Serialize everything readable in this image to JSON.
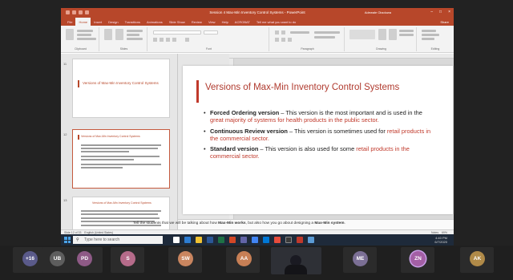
{
  "window": {
    "title": "Session 4 Max-Min Inventory Control Systems - PowerPoint",
    "user": "Adewale Olaoluwa",
    "controls": [
      "–",
      "□",
      "×"
    ]
  },
  "ribbon": {
    "tabs": [
      "File",
      "Home",
      "Insert",
      "Design",
      "Transitions",
      "Animations",
      "Slide Show",
      "Review",
      "View",
      "Help",
      "ACROBAT",
      "Tell me what you want to do"
    ],
    "active_tab": "Home",
    "share_label": "Share",
    "groups": [
      "Clipboard",
      "Slides",
      "Font",
      "Paragraph",
      "Drawing",
      "Editing"
    ]
  },
  "thumbnails": [
    {
      "num": "11",
      "title": "Versions of Max-Min Inventory Control Systems"
    },
    {
      "num": "12",
      "title": "Versions of Max-Min Inventory Control Systems"
    },
    {
      "num": "13",
      "title": "Versions of Max-Min Inventory Control Systems"
    }
  ],
  "slide": {
    "title": "Versions of Max-Min Inventory Control Systems",
    "bullets": [
      {
        "bold": "Forced Ordering version",
        "plain": " – This version is the most important and is used in the ",
        "red": "great majority of systems for health products in the public sector."
      },
      {
        "bold": "Continuous Review version",
        "plain": " – This version is sometimes used for ",
        "red": "retail products in the commercial sector."
      },
      {
        "bold": "Standard version",
        "plain": " – This version is also used for some ",
        "red": "retail products in the commercial sector."
      }
    ]
  },
  "notes": {
    "prefix": "Tell the students that we will be talking about how ",
    "bold1": "Max-Min works",
    "middle": ", but also how you go about designing a ",
    "bold2": "Max-Min system",
    "suffix": "."
  },
  "statusbar": {
    "slide_info": "Slide 12 of 33",
    "language": "English (United States)",
    "notes_label": "Notes",
    "zoom": "69%"
  },
  "taskbar": {
    "search_placeholder": "Type here to search",
    "time": "4:40 PM",
    "date": "6/7/2020"
  },
  "participants": [
    {
      "initials": "+16",
      "color": "#5a5a8a"
    },
    {
      "initials": "UB",
      "color": "#5d5d5d"
    },
    {
      "initials": "PD",
      "color": "#8e5a86"
    },
    {
      "initials": "S",
      "color": "#b56b8a"
    },
    {
      "initials": "SW",
      "color": "#c9855f"
    },
    {
      "initials": "AA",
      "color": "#c77f55"
    },
    {
      "initials": "ME",
      "color": "#7b6f95"
    },
    {
      "initials": "ZN",
      "color": "#a35fa5"
    },
    {
      "initials": "AK",
      "color": "#b08a48"
    }
  ]
}
